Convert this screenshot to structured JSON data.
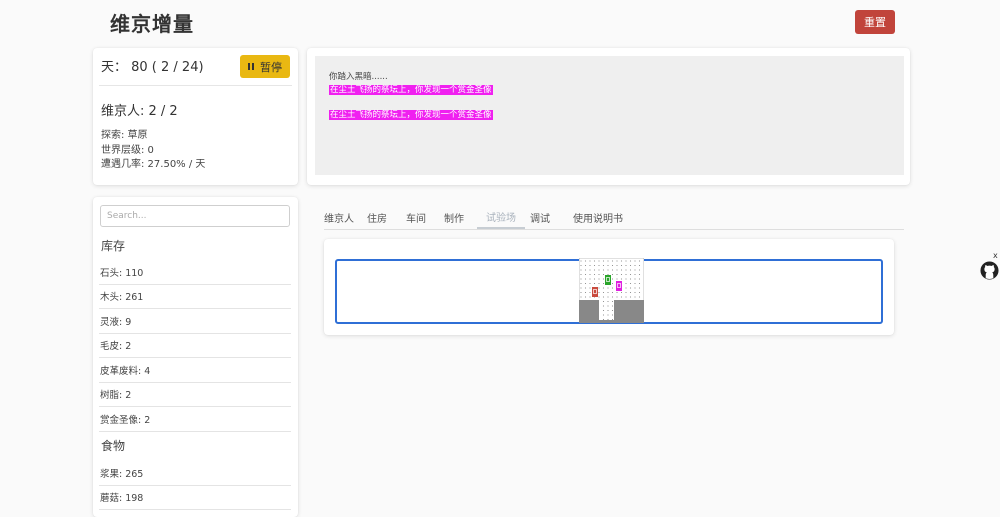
{
  "app": {
    "title": "维京增量",
    "reset_label": "重置"
  },
  "status": {
    "day_text": "天：  80 ( 2 / 24)",
    "pause_label": "暂停",
    "villagers_text": "维京人: 2 / 2",
    "explore_text": "探索: 草原",
    "world_level_text": "世界层级: 0",
    "encounter_text": "遭遇几率: 27.50% / 天"
  },
  "log": {
    "lines": [
      {
        "text": "你踏入黑暗......",
        "highlight": false
      },
      {
        "text": "在尘土飞扬的祭坛上，你发现一个赏金圣像",
        "highlight": true
      },
      {
        "text": "",
        "highlight": false
      },
      {
        "text": "在尘土飞扬的祭坛上，你发现一个赏金圣像",
        "highlight": true
      }
    ],
    "highlight_color": "#f020f0"
  },
  "inventory": {
    "search_placeholder": "Search...",
    "stock_title": "库存",
    "stock_items": [
      "石头: 110",
      "木头: 261",
      "灵液: 9",
      "毛皮: 2",
      "皮革废料: 4",
      "树脂: 2",
      "赏金圣像: 2"
    ],
    "food_title": "食物",
    "food_items": [
      "浆果: 265",
      "蘑菇: 198"
    ]
  },
  "tabs": [
    {
      "label": "维京人",
      "active": false
    },
    {
      "label": "住房",
      "active": false
    },
    {
      "label": "车间",
      "active": false
    },
    {
      "label": "制作",
      "active": false
    },
    {
      "label": "试验场",
      "active": true
    },
    {
      "label": "调试",
      "active": false
    },
    {
      "label": "使用说明书",
      "active": false
    }
  ],
  "colors": {
    "reset": "#c1443b",
    "pause": "#e9b812",
    "frame": "#2f6fd6",
    "unit_green": "#2aa52a",
    "unit_red": "#c94b3e",
    "unit_magenta": "#e020e0"
  },
  "icons": {
    "pause": "pause-icon",
    "github": "github-icon",
    "close": "close-icon"
  }
}
